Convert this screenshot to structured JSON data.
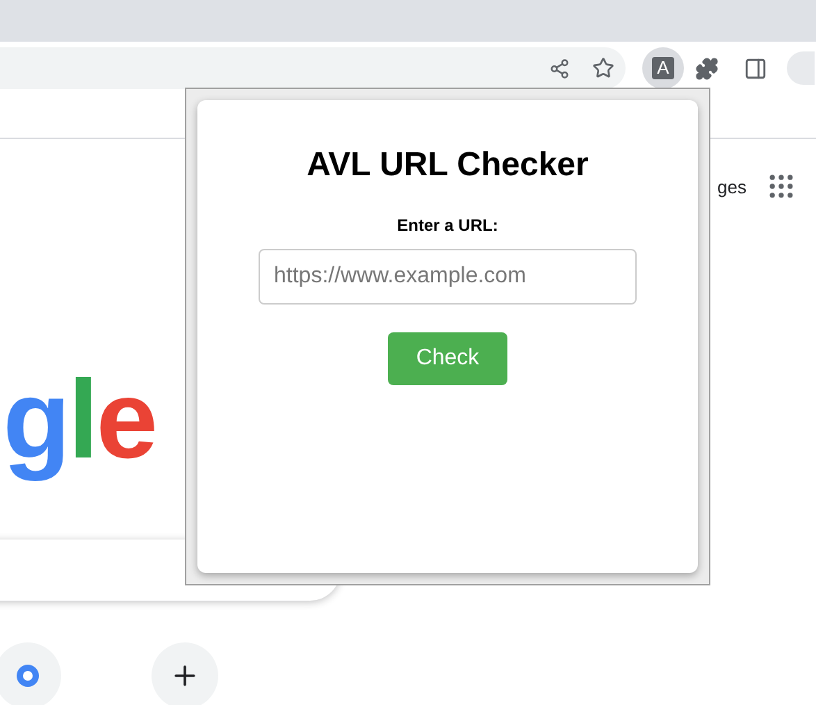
{
  "browser": {
    "extension_button": {
      "letter": "A",
      "active": true
    }
  },
  "page": {
    "header_link": "ges",
    "logo": [
      {
        "text": "g",
        "color": "#4285f4"
      },
      {
        "text": "l",
        "color": "#34a853"
      },
      {
        "text": "e",
        "color": "#ea4335"
      }
    ]
  },
  "popup": {
    "title": "AVL URL Checker",
    "label": "Enter a URL:",
    "url_field": {
      "placeholder": "https://www.example.com"
    },
    "button": "Check"
  }
}
